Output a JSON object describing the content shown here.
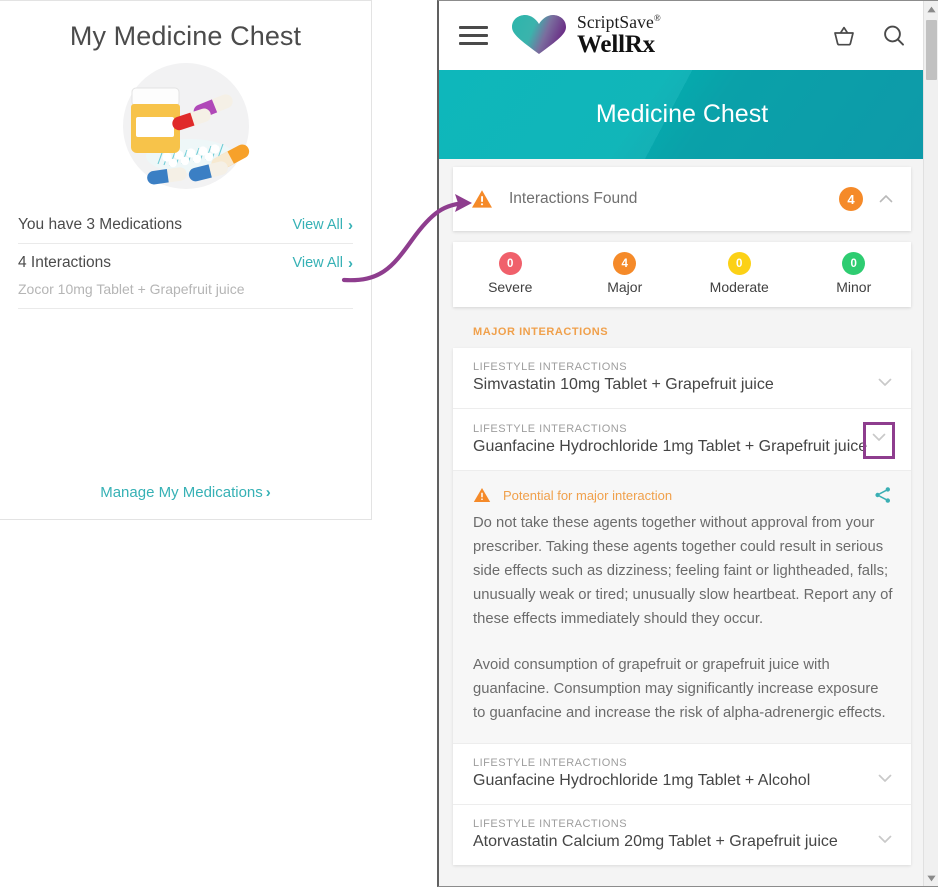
{
  "left_panel": {
    "title": "My Medicine Chest",
    "art_icon": "pill-bottle-and-pills-illustration",
    "rows": [
      {
        "label": "You have 3 Medications",
        "action": "View All",
        "chevron": "chevron-right-icon"
      },
      {
        "label": "4 Interactions",
        "action": "View All",
        "chevron": "chevron-right-icon"
      }
    ],
    "interaction_summary": "Zocor 10mg Tablet + Grapefruit juice",
    "manage_link": "Manage My Medications",
    "manage_chevron": "chevron-right-icon",
    "link_color": "#36b1b5"
  },
  "browser": {
    "header": {
      "menu_icon": "hamburger-menu-icon",
      "brand_top": "ScriptSave",
      "brand_trademark": "®",
      "brand_bottom": "WellRx",
      "logo_icon": "wellrx-heart-logo",
      "cart_icon": "basket-icon",
      "search_icon": "search-icon"
    },
    "banner": {
      "title": "Medicine Chest",
      "color": "#00b3b7"
    },
    "interactions_panel": {
      "warning_icon": "warning-triangle-icon",
      "title": "Interactions Found",
      "count": "4",
      "count_color": "#f58a29",
      "collapse_icon": "chevron-up-icon"
    },
    "severity": [
      {
        "name": "Severe",
        "count": "0",
        "color": "#f0606b"
      },
      {
        "name": "Major",
        "count": "4",
        "color": "#f58a29"
      },
      {
        "name": "Moderate",
        "count": "0",
        "color": "#fcd116"
      },
      {
        "name": "Minor",
        "count": "0",
        "color": "#2ecc71"
      }
    ],
    "section_heading": "MAJOR INTERACTIONS",
    "interactions": [
      {
        "kicker": "LIFESTYLE INTERACTIONS",
        "title": "Simvastatin 10mg Tablet + Grapefruit juice",
        "chevron": "chevron-down-icon",
        "expanded": false,
        "highlighted": false
      },
      {
        "kicker": "LIFESTYLE INTERACTIONS",
        "title": "Guanfacine Hydrochloride 1mg Tablet + Grapefruit juice",
        "chevron": "chevron-down-icon",
        "expanded": true,
        "highlighted": true,
        "highlight_color": "#8e3d8e"
      },
      {
        "kicker": "LIFESTYLE INTERACTIONS",
        "title": "Guanfacine Hydrochloride 1mg Tablet + Alcohol",
        "chevron": "chevron-down-icon",
        "expanded": false,
        "highlighted": false
      },
      {
        "kicker": "LIFESTYLE INTERACTIONS",
        "title": "Atorvastatin Calcium 20mg Tablet + Grapefruit juice",
        "chevron": "chevron-down-icon",
        "expanded": false,
        "highlighted": false
      }
    ],
    "detail": {
      "warning_icon": "warning-triangle-icon",
      "heading": "Potential for major interaction",
      "heading_color": "#f0a04b",
      "share_icon": "share-icon",
      "paragraph_1": "Do not take these agents together without approval from your prescriber. Taking these agents together could result in serious side effects such as dizziness; feeling faint or lightheaded, falls; unusually weak or tired; unusually slow heartbeat. Report any of these effects immediately should they occur.",
      "paragraph_2": "Avoid consumption of grapefruit or grapefruit juice with guanfacine. Consumption may significantly increase exposure to guanfacine and increase the risk of alpha-adrenergic effects."
    },
    "scrollbar": {
      "up_arrow": "scroll-up-arrow-icon",
      "down_arrow": "scroll-down-arrow-icon"
    }
  },
  "annotation": {
    "arrow_icon": "curved-pointer-arrow",
    "color": "#8e3d8e"
  }
}
